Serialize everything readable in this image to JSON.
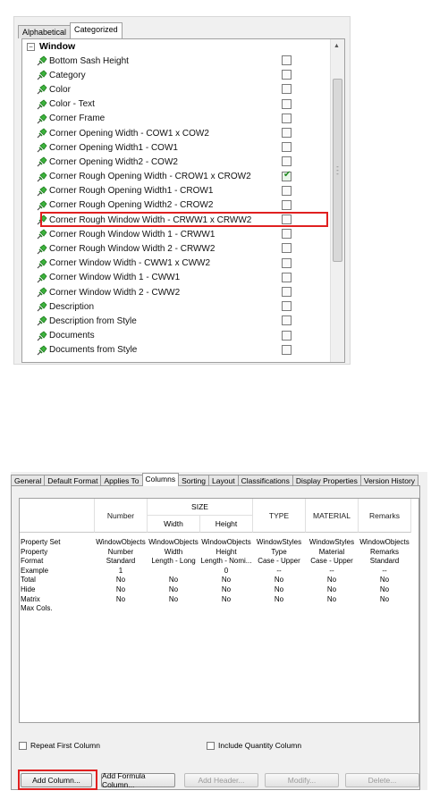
{
  "property_picker": {
    "tabs": [
      "Alphabetical",
      "Categorized"
    ],
    "active_tab": "Categorized",
    "group_label": "Window",
    "rows": [
      {
        "label": "Bottom Sash Height",
        "checked": false
      },
      {
        "label": "Category",
        "checked": false
      },
      {
        "label": "Color",
        "checked": false
      },
      {
        "label": "Color - Text",
        "checked": false
      },
      {
        "label": "Corner Frame",
        "checked": false
      },
      {
        "label": "Corner Opening Width - COW1 x COW2",
        "checked": false
      },
      {
        "label": "Corner Opening Width1 - COW1",
        "checked": false
      },
      {
        "label": "Corner Opening Width2 - COW2",
        "checked": false
      },
      {
        "label": "Corner Rough Opening Width - CROW1 x CROW2",
        "checked": true
      },
      {
        "label": "Corner Rough Opening Width1 - CROW1",
        "checked": false
      },
      {
        "label": "Corner Rough Opening Width2 - CROW2",
        "checked": false
      },
      {
        "label": "Corner Rough Window Width - CRWW1 x CRWW2",
        "checked": false
      },
      {
        "label": "Corner Rough Window Width 1 - CRWW1",
        "checked": false
      },
      {
        "label": "Corner Rough Window Width 2 - CRWW2",
        "checked": false
      },
      {
        "label": "Corner Window Width - CWW1 x CWW2",
        "checked": false
      },
      {
        "label": "Corner Window Width 1 - CWW1",
        "checked": false
      },
      {
        "label": "Corner Window Width 2 - CWW2",
        "checked": false
      },
      {
        "label": "Description",
        "checked": false
      },
      {
        "label": "Description from Style",
        "checked": false
      },
      {
        "label": "Documents",
        "checked": false
      },
      {
        "label": "Documents from Style",
        "checked": false
      }
    ]
  },
  "schedule_dialog": {
    "tabs": [
      "General",
      "Default Format",
      "Applies To",
      "Columns",
      "Sorting",
      "Layout",
      "Classifications",
      "Display Properties",
      "Version History"
    ],
    "active_tab": "Columns",
    "column_headers": {
      "number": "Number",
      "size_group": "SIZE",
      "width": "Width",
      "height": "Height",
      "type": "TYPE",
      "material": "MATERIAL",
      "remarks": "Remarks"
    },
    "rows": [
      {
        "label": "Property Set",
        "cells": [
          "WindowObjects",
          "WindowObjects",
          "WindowObjects",
          "WindowStyles",
          "WindowStyles",
          "WindowObjects"
        ]
      },
      {
        "label": "Property",
        "cells": [
          "Number",
          "Width",
          "Height",
          "Type",
          "Material",
          "Remarks"
        ]
      },
      {
        "label": "Format",
        "cells": [
          "Standard",
          "Length - Long",
          "Length - Nomi...",
          "Case - Upper",
          "Case - Upper",
          "Standard"
        ]
      },
      {
        "label": "Example",
        "cells": [
          "1",
          "",
          "0",
          "--",
          "--",
          "--"
        ]
      },
      {
        "label": "Total",
        "cells": [
          "No",
          "No",
          "No",
          "No",
          "No",
          "No"
        ]
      },
      {
        "label": "Hide",
        "cells": [
          "No",
          "No",
          "No",
          "No",
          "No",
          "No"
        ]
      },
      {
        "label": "Matrix",
        "cells": [
          "No",
          "No",
          "No",
          "No",
          "No",
          "No"
        ]
      },
      {
        "label": "Max Cols.",
        "cells": [
          "",
          "",
          "",
          "",
          "",
          ""
        ]
      }
    ],
    "options": {
      "repeat_first_column": {
        "label": "Repeat First Column",
        "checked": false
      },
      "include_quantity_column": {
        "label": "Include Quantity Column",
        "checked": false
      }
    },
    "buttons": {
      "add_column": "Add Column...",
      "add_formula_column": "Add Formula Column...",
      "add_header": "Add Header...",
      "modify": "Modify...",
      "delete": "Delete..."
    }
  }
}
